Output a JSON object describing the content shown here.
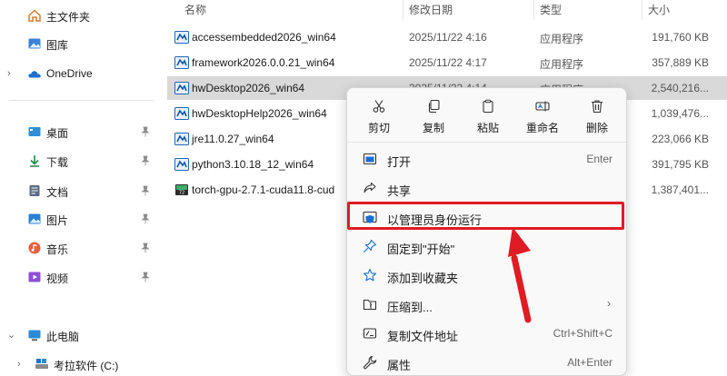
{
  "sidebar": {
    "items": [
      {
        "label": "主文件夹",
        "icon": "home-icon"
      },
      {
        "label": "图库",
        "icon": "gallery-icon"
      },
      {
        "label": "OneDrive",
        "icon": "cloud-icon"
      },
      {
        "label": "桌面",
        "icon": "desktop-icon"
      },
      {
        "label": "下载",
        "icon": "download-icon"
      },
      {
        "label": "文档",
        "icon": "document-icon"
      },
      {
        "label": "图片",
        "icon": "pictures-icon"
      },
      {
        "label": "音乐",
        "icon": "music-icon"
      },
      {
        "label": "视频",
        "icon": "video-icon"
      },
      {
        "label": "此电脑",
        "icon": "computer-icon"
      },
      {
        "label": "考拉软件 (C:)",
        "icon": "drive-icon"
      }
    ]
  },
  "columns": {
    "name": "名称",
    "date": "修改日期",
    "type": "类型",
    "size": "大小"
  },
  "files": [
    {
      "name": "accessembedded2026_win64",
      "date": "2025/11/22 4:16",
      "type": "应用程序",
      "size": "191,760 KB"
    },
    {
      "name": "framework2026.0.0.21_win64",
      "date": "2025/11/22 4:17",
      "type": "应用程序",
      "size": "357,889 KB"
    },
    {
      "name": "hwDesktop2026_win64",
      "date": "2025/11/22 4:14",
      "type": "应用程序",
      "size": "2,540,216..."
    },
    {
      "name": "hwDesktopHelp2026_win64",
      "date": "",
      "type": "",
      "size": "1,039,476..."
    },
    {
      "name": "jre11.0.27_win64",
      "date": "",
      "type": "",
      "size": "223,066 KB"
    },
    {
      "name": "python3.10.18_12_win64",
      "date": "",
      "type": "",
      "size": "391,795 KB"
    },
    {
      "name": "torch-gpu-2.7.1-cuda11.8-cud",
      "date": "",
      "type": "",
      "size": "1,387,401..."
    }
  ],
  "context_menu": {
    "quick_actions": [
      {
        "label": "剪切",
        "icon": "cut-icon"
      },
      {
        "label": "复制",
        "icon": "copy-icon"
      },
      {
        "label": "粘贴",
        "icon": "paste-icon"
      },
      {
        "label": "重命名",
        "icon": "rename-icon"
      },
      {
        "label": "删除",
        "icon": "delete-icon"
      }
    ],
    "items": [
      {
        "label": "打开",
        "shortcut": "Enter"
      },
      {
        "label": "共享",
        "shortcut": ""
      },
      {
        "label": "以管理员身份运行",
        "shortcut": ""
      },
      {
        "label": "固定到\"开始\"",
        "shortcut": ""
      },
      {
        "label": "添加到收藏夹",
        "shortcut": ""
      },
      {
        "label": "压缩到...",
        "shortcut": ""
      },
      {
        "label": "复制文件地址",
        "shortcut": "Ctrl+Shift+C"
      },
      {
        "label": "属性",
        "shortcut": "Alt+Enter"
      }
    ]
  },
  "colors": {
    "accent": "#0067c0",
    "highlight": "#e01b24",
    "selected_row": "#d9d9d9"
  }
}
